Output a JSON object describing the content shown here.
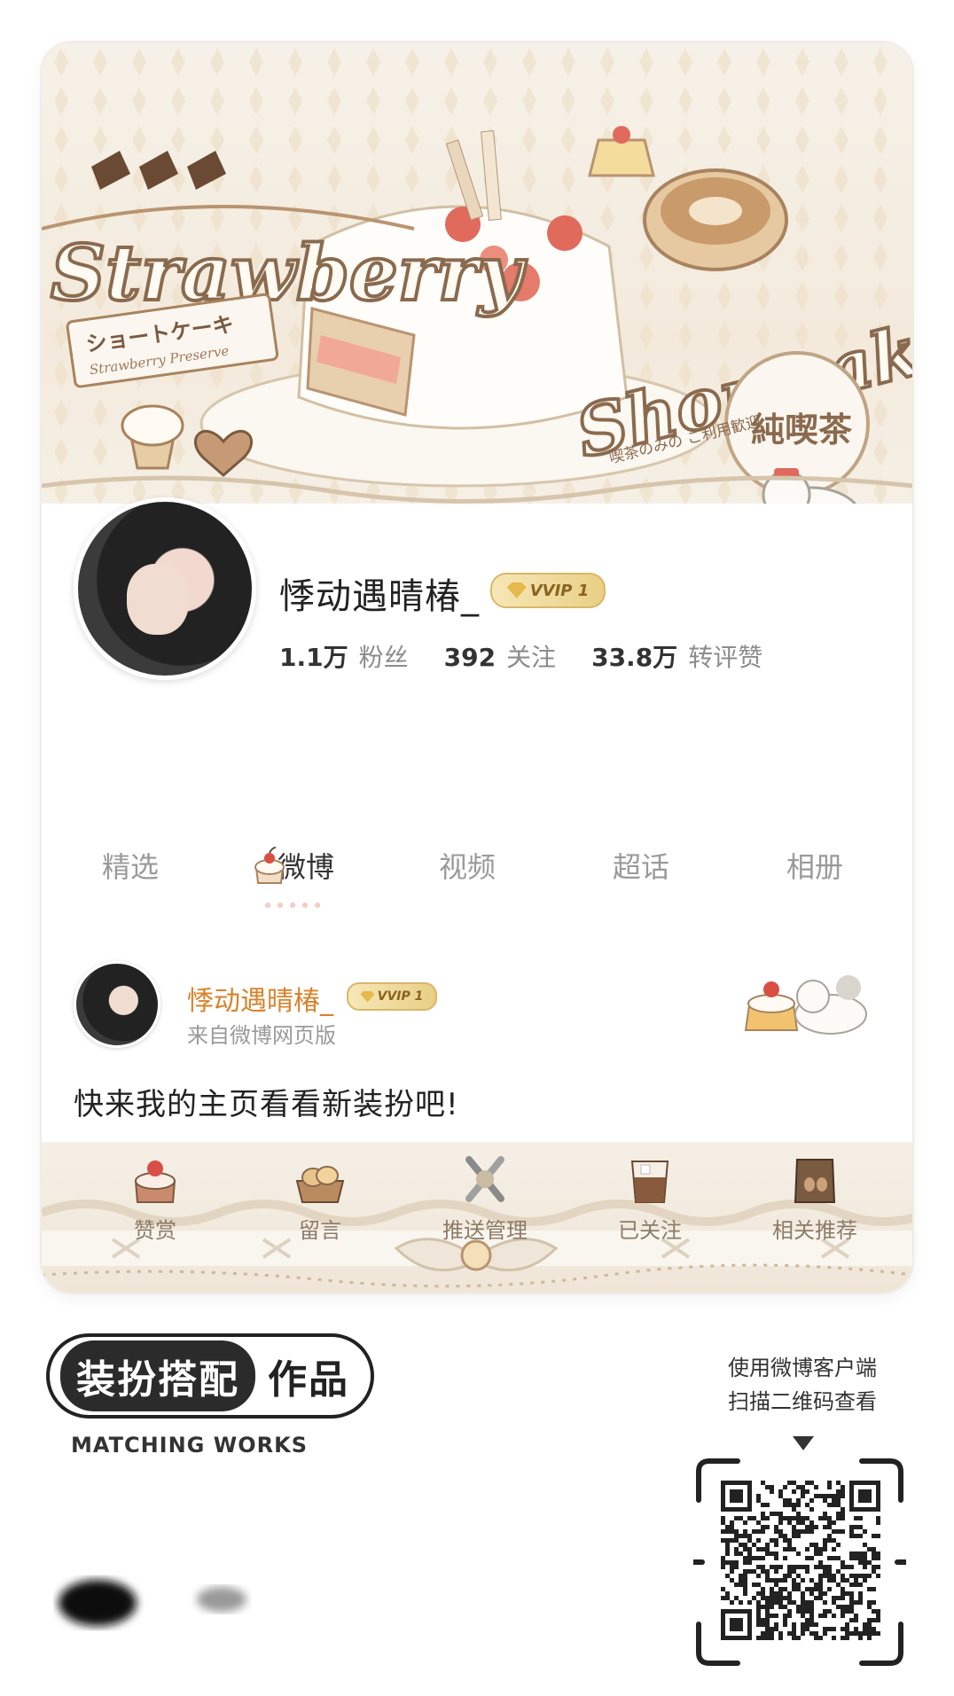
{
  "banner": {
    "title_left": "Strawberry",
    "title_right": "Shortcake",
    "sign_jp": "ショートケーキ",
    "sign_en": "Strawberry Preserve",
    "cafe_badge": "純喫茶",
    "cafe_note": "喫茶のみの ご利用歓迎"
  },
  "profile": {
    "name": "悸动遇晴椿_",
    "badge": "VVIP 1",
    "stats": [
      {
        "value": "1.1万",
        "label": "粉丝"
      },
      {
        "value": "392",
        "label": "关注"
      },
      {
        "value": "33.8万",
        "label": "转评赞"
      }
    ]
  },
  "tabs": [
    "精选",
    "微博",
    "视频",
    "超话",
    "相册"
  ],
  "active_tab": "微博",
  "post": {
    "author": "悸动遇晴椿_",
    "badge": "VVIP 1",
    "source": "来自微博网页版",
    "text": "快来我的主页看看新装扮吧!"
  },
  "actions": [
    {
      "label": "赞赏",
      "icon": "strawberry-cake-icon"
    },
    {
      "label": "留言",
      "icon": "bread-basket-icon"
    },
    {
      "label": "推送管理",
      "icon": "utensils-icon"
    },
    {
      "label": "已关注",
      "icon": "iced-coffee-icon"
    },
    {
      "label": "相关推荐",
      "icon": "coffee-bag-icon"
    }
  ],
  "footer": {
    "works_pill": "装扮搭配",
    "works_tail": "作品",
    "works_en": "MATCHING WORKS",
    "qr_tip_line1": "使用微博客户端",
    "qr_tip_line2": "扫描二维码查看"
  },
  "colors": {
    "accent_name": "#d9822b",
    "vvip_gold": "#e9cf86",
    "cream_bg": "#f3eadc",
    "brown_text": "#8c7b68"
  }
}
